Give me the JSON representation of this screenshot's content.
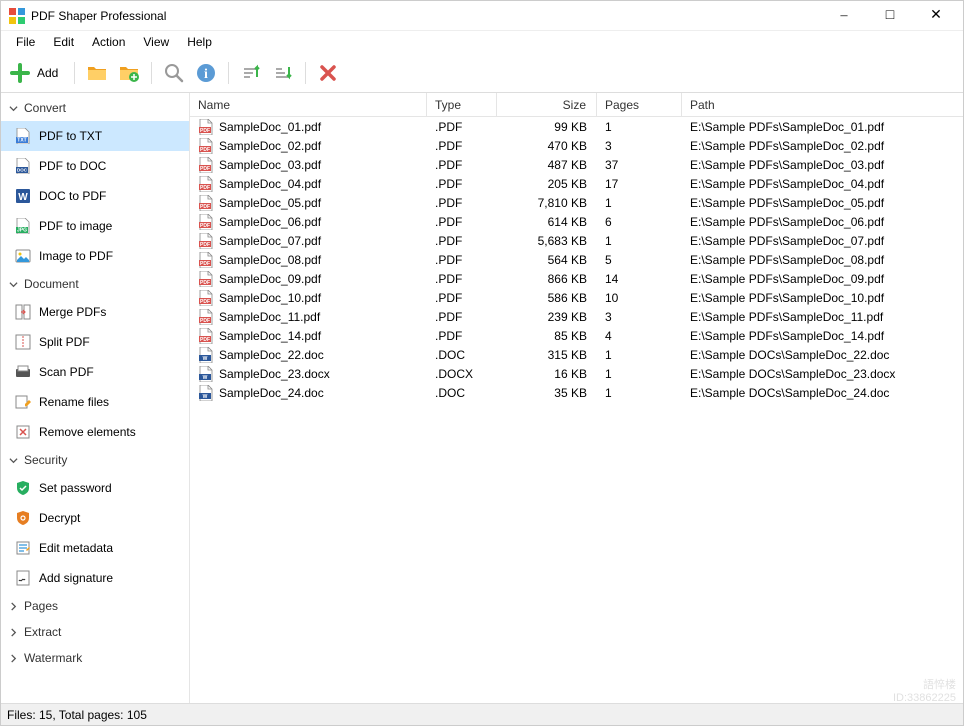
{
  "window": {
    "title": "PDF Shaper Professional"
  },
  "menubar": [
    "File",
    "Edit",
    "Action",
    "View",
    "Help"
  ],
  "toolbar": {
    "add_label": "Add"
  },
  "sidebar": {
    "sections": [
      {
        "title": "Convert",
        "expanded": true,
        "items": [
          {
            "label": "PDF to TXT",
            "icon": "txt",
            "selected": true
          },
          {
            "label": "PDF to DOC",
            "icon": "doc"
          },
          {
            "label": "DOC to PDF",
            "icon": "word"
          },
          {
            "label": "PDF to image",
            "icon": "jpg"
          },
          {
            "label": "Image to PDF",
            "icon": "imgpdf"
          }
        ]
      },
      {
        "title": "Document",
        "expanded": true,
        "items": [
          {
            "label": "Merge PDFs",
            "icon": "merge"
          },
          {
            "label": "Split PDF",
            "icon": "split"
          },
          {
            "label": "Scan PDF",
            "icon": "scan"
          },
          {
            "label": "Rename files",
            "icon": "rename"
          },
          {
            "label": "Remove elements",
            "icon": "remove"
          }
        ]
      },
      {
        "title": "Security",
        "expanded": true,
        "items": [
          {
            "label": "Set password",
            "icon": "shield_g"
          },
          {
            "label": "Decrypt",
            "icon": "shield_o"
          },
          {
            "label": "Edit metadata",
            "icon": "meta"
          },
          {
            "label": "Add signature",
            "icon": "sig"
          }
        ]
      },
      {
        "title": "Pages",
        "expanded": false,
        "items": []
      },
      {
        "title": "Extract",
        "expanded": false,
        "items": []
      },
      {
        "title": "Watermark",
        "expanded": false,
        "items": []
      }
    ]
  },
  "columns": {
    "name": "Name",
    "type": "Type",
    "size": "Size",
    "pages": "Pages",
    "path": "Path"
  },
  "files": [
    {
      "name": "SampleDoc_01.pdf",
      "type": ".PDF",
      "size": "99 KB",
      "pages": "1",
      "path": "E:\\Sample PDFs\\SampleDoc_01.pdf",
      "icon": "pdf"
    },
    {
      "name": "SampleDoc_02.pdf",
      "type": ".PDF",
      "size": "470 KB",
      "pages": "3",
      "path": "E:\\Sample PDFs\\SampleDoc_02.pdf",
      "icon": "pdf"
    },
    {
      "name": "SampleDoc_03.pdf",
      "type": ".PDF",
      "size": "487 KB",
      "pages": "37",
      "path": "E:\\Sample PDFs\\SampleDoc_03.pdf",
      "icon": "pdf"
    },
    {
      "name": "SampleDoc_04.pdf",
      "type": ".PDF",
      "size": "205 KB",
      "pages": "17",
      "path": "E:\\Sample PDFs\\SampleDoc_04.pdf",
      "icon": "pdf"
    },
    {
      "name": "SampleDoc_05.pdf",
      "type": ".PDF",
      "size": "7,810 KB",
      "pages": "1",
      "path": "E:\\Sample PDFs\\SampleDoc_05.pdf",
      "icon": "pdf"
    },
    {
      "name": "SampleDoc_06.pdf",
      "type": ".PDF",
      "size": "614 KB",
      "pages": "6",
      "path": "E:\\Sample PDFs\\SampleDoc_06.pdf",
      "icon": "pdf"
    },
    {
      "name": "SampleDoc_07.pdf",
      "type": ".PDF",
      "size": "5,683 KB",
      "pages": "1",
      "path": "E:\\Sample PDFs\\SampleDoc_07.pdf",
      "icon": "pdf"
    },
    {
      "name": "SampleDoc_08.pdf",
      "type": ".PDF",
      "size": "564 KB",
      "pages": "5",
      "path": "E:\\Sample PDFs\\SampleDoc_08.pdf",
      "icon": "pdf"
    },
    {
      "name": "SampleDoc_09.pdf",
      "type": ".PDF",
      "size": "866 KB",
      "pages": "14",
      "path": "E:\\Sample PDFs\\SampleDoc_09.pdf",
      "icon": "pdf"
    },
    {
      "name": "SampleDoc_10.pdf",
      "type": ".PDF",
      "size": "586 KB",
      "pages": "10",
      "path": "E:\\Sample PDFs\\SampleDoc_10.pdf",
      "icon": "pdf"
    },
    {
      "name": "SampleDoc_11.pdf",
      "type": ".PDF",
      "size": "239 KB",
      "pages": "3",
      "path": "E:\\Sample PDFs\\SampleDoc_11.pdf",
      "icon": "pdf"
    },
    {
      "name": "SampleDoc_14.pdf",
      "type": ".PDF",
      "size": "85 KB",
      "pages": "4",
      "path": "E:\\Sample PDFs\\SampleDoc_14.pdf",
      "icon": "pdf"
    },
    {
      "name": "SampleDoc_22.doc",
      "type": ".DOC",
      "size": "315 KB",
      "pages": "1",
      "path": "E:\\Sample DOCs\\SampleDoc_22.doc",
      "icon": "doc"
    },
    {
      "name": "SampleDoc_23.docx",
      "type": ".DOCX",
      "size": "16 KB",
      "pages": "1",
      "path": "E:\\Sample DOCs\\SampleDoc_23.docx",
      "icon": "doc"
    },
    {
      "name": "SampleDoc_24.doc",
      "type": ".DOC",
      "size": "35 KB",
      "pages": "1",
      "path": "E:\\Sample DOCs\\SampleDoc_24.doc",
      "icon": "doc"
    }
  ],
  "statusbar": {
    "text": "Files: 15, Total pages: 105"
  },
  "watermark": {
    "line1": "語悴楼",
    "line2": "ID:33862225"
  }
}
